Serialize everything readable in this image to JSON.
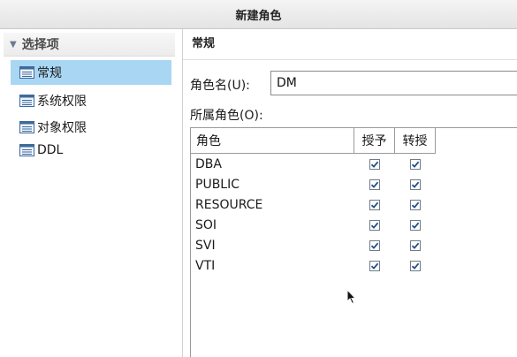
{
  "window": {
    "title": "新建角色"
  },
  "sidebar": {
    "header": "选择项",
    "items": [
      {
        "label": "常规",
        "icon": "page-icon",
        "selected": true
      },
      {
        "label": "系统权限",
        "icon": "page-icon",
        "selected": false
      },
      {
        "label": "对象权限",
        "icon": "page-icon",
        "selected": false
      },
      {
        "label": "DDL",
        "icon": "page-icon",
        "selected": false
      }
    ]
  },
  "main": {
    "section_title": "常规",
    "role_name": {
      "label": "角色名(U):",
      "value": "DM"
    },
    "roles_label": "所属角色(O):",
    "table": {
      "columns": [
        "角色",
        "授予",
        "转授"
      ],
      "rows": [
        {
          "name": "DBA",
          "grant": true,
          "admin": true
        },
        {
          "name": "PUBLIC",
          "grant": true,
          "admin": true
        },
        {
          "name": "RESOURCE",
          "grant": true,
          "admin": true
        },
        {
          "name": "SOI",
          "grant": true,
          "admin": true
        },
        {
          "name": "SVI",
          "grant": true,
          "admin": true
        },
        {
          "name": "VTI",
          "grant": true,
          "admin": true
        }
      ]
    }
  },
  "colors": {
    "selection": "#a9d6f2",
    "checkmark": "#1f4f8a",
    "border": "#9a9a9a"
  }
}
